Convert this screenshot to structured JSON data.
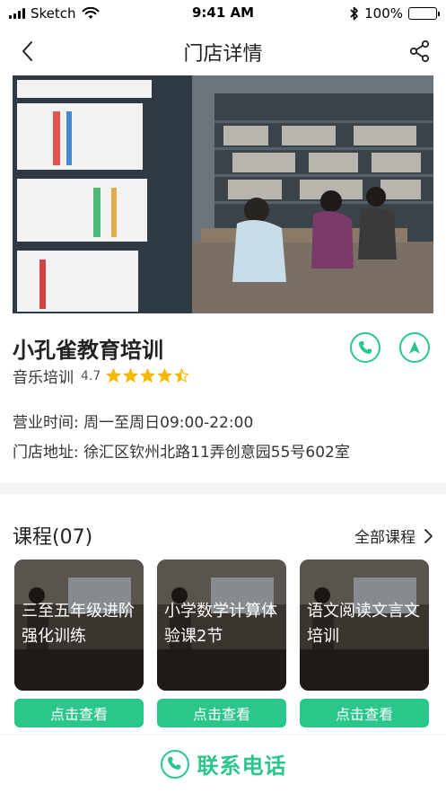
{
  "status_bar": {
    "carrier": "Sketch",
    "time": "9:41 AM",
    "battery": "100%"
  },
  "nav": {
    "title": "门店详情",
    "back_icon": "chevron-left-icon",
    "share_icon": "share-icon"
  },
  "store": {
    "name": "小孔雀教育培训",
    "category": "音乐培训",
    "rating_value": "4.7",
    "rating_stars": 4.5,
    "rating_max": 5,
    "hours_label": "营业时间:",
    "hours_value": "周一至周日09:00-22:00",
    "address_label": "门店地址:",
    "address_value": "徐汇区钦州北路11弄创意园55号602室"
  },
  "courses_section": {
    "title": "课程(07)",
    "all_link": "全部课程",
    "items": [
      {
        "name": "三至五年级进阶强化训练",
        "button": "点击查看"
      },
      {
        "name": "小学数学计算体验课2节",
        "button": "点击查看"
      },
      {
        "name": "语文阅读文言文培训",
        "button": "点击查看"
      }
    ]
  },
  "bottom_bar": {
    "label": "联系电话"
  },
  "colors": {
    "accent": "#2bc68a",
    "star": "#f5b800",
    "divider": "#f4f4f4"
  }
}
